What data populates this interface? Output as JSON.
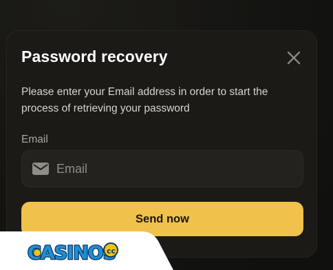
{
  "modal": {
    "title": "Password recovery",
    "description": "Please enter your Email address in order to start the process of retrieving your password",
    "email_label": "Email",
    "email_placeholder": "Email",
    "email_value": "",
    "send_button_label": "Send now",
    "close_icon": "close-icon",
    "field_icon": "envelope-icon"
  },
  "watermark": {
    "logo_text": "CASINOS",
    "logo_suffix": ".cc"
  },
  "colors": {
    "background": "#151513",
    "modal_bg": "#1b1a17",
    "input_bg": "#23221e",
    "accent_button": "#f0c14b",
    "title_text": "#ffffff",
    "body_text": "#d6d5d0",
    "muted_text": "#a9a79f",
    "logo_blue": "#1e8fd6",
    "logo_yellow": "#f2c21b"
  }
}
